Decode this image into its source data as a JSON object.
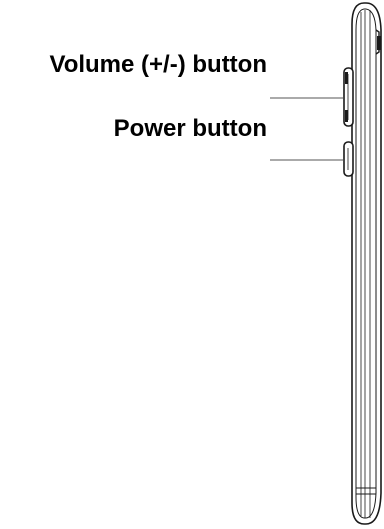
{
  "callouts": {
    "volume_label": "Volume (+/-) button",
    "power_label": "Power button"
  },
  "colors": {
    "outline": "#1a1a1a",
    "leader_line": "#555555",
    "background": "#ffffff"
  }
}
